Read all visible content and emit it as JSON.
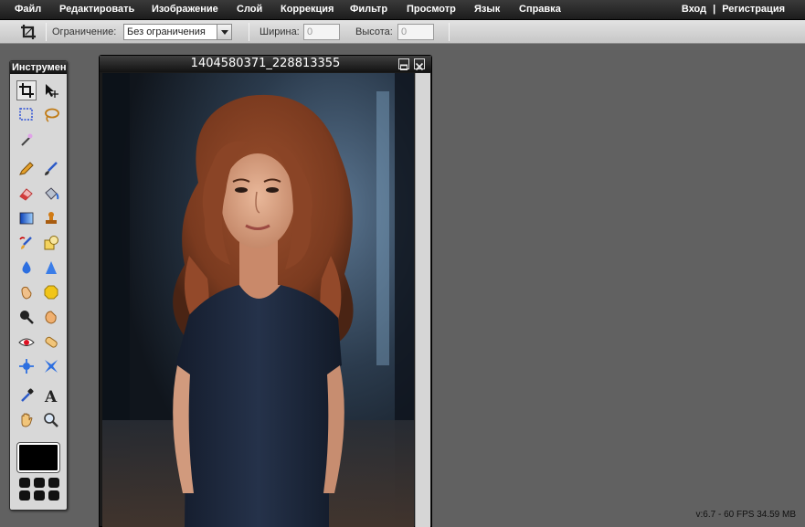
{
  "menu": {
    "items": [
      "Файл",
      "Редактировать",
      "Изображение",
      "Слой",
      "Коррекция",
      "Фильтр",
      "Просмотр",
      "Язык",
      "Справка"
    ],
    "login": "Вход",
    "separator": "|",
    "register": "Регистрация"
  },
  "options": {
    "constraint_label": "Ограничение:",
    "constraint_value": "Без ограничения",
    "width_label": "Ширина:",
    "width_value": "0",
    "height_label": "Высота:",
    "height_value": "0"
  },
  "toolbox": {
    "title": "Инструмен",
    "tools": [
      "crop-tool",
      "move-tool",
      "marquee-tool",
      "lasso-tool",
      "magic-wand-tool",
      "pencil-tool",
      "brush-tool",
      "eraser-tool",
      "paint-bucket-tool",
      "gradient-tool",
      "clone-stamp-tool",
      "color-replace-tool",
      "draw-shapes-tool",
      "blur-tool",
      "sharpen-tool",
      "smudge-tool",
      "sponge-tool",
      "dodge-tool",
      "burn-tool",
      "red-eye-tool",
      "spot-heal-tool",
      "bloat-tool",
      "pinch-tool",
      "color-picker-tool",
      "type-tool",
      "hand-tool",
      "zoom-tool"
    ],
    "primary_color": "#000000"
  },
  "document": {
    "title": "1404580371_228813355"
  },
  "status": {
    "version": "v:6.7 - 60 FPS 34.59 MB"
  },
  "colors": {
    "workspace": "#616161",
    "menubar": "#1c1c1c",
    "toolbar": "#d0d0d0"
  }
}
